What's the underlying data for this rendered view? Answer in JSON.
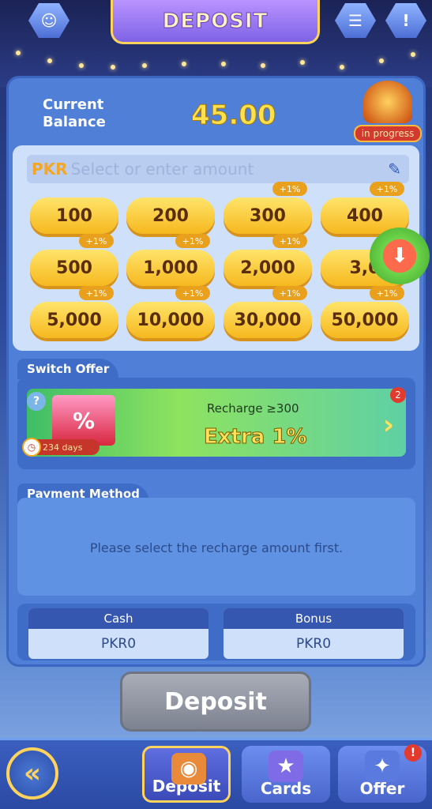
{
  "header": {
    "title": "DEPOSIT",
    "left_icon": "support-icon",
    "right_icons": [
      "notes-icon",
      "alert-icon"
    ]
  },
  "balance": {
    "label_line1": "Current",
    "label_line2": "Balance",
    "value": "45.00",
    "progress_badge": "in progress"
  },
  "amount": {
    "currency": "PKR",
    "placeholder": "Select or enter amount",
    "options": [
      {
        "value": "100",
        "bonus": ""
      },
      {
        "value": "200",
        "bonus": ""
      },
      {
        "value": "300",
        "bonus": "+1%"
      },
      {
        "value": "400",
        "bonus": "+1%"
      },
      {
        "value": "500",
        "bonus": "+1%"
      },
      {
        "value": "1,000",
        "bonus": "+1%"
      },
      {
        "value": "2,000",
        "bonus": "+1%"
      },
      {
        "value": "3,0",
        "bonus": ""
      },
      {
        "value": "5,000",
        "bonus": "+1%"
      },
      {
        "value": "10,000",
        "bonus": "+1%"
      },
      {
        "value": "30,000",
        "bonus": "+1%"
      },
      {
        "value": "50,000",
        "bonus": "+1%"
      }
    ]
  },
  "offer": {
    "section_label": "Switch Offer",
    "title": "Recharge ≥300",
    "extra": "Extra  1%",
    "days": "234 days",
    "count_badge": "2",
    "img_symbol": "%",
    "help": "?"
  },
  "payment": {
    "section_label": "Payment Method",
    "message": "Please select the recharge amount first."
  },
  "wallets": [
    {
      "label": "Cash",
      "value": "PKR0"
    },
    {
      "label": "Bonus",
      "value": "PKR0"
    }
  ],
  "deposit_button": "Deposit",
  "bottom_nav": [
    {
      "label": "Deposit",
      "icon": "coins-icon"
    },
    {
      "label": "Cards",
      "icon": "cards-icon"
    },
    {
      "label": "Offer",
      "icon": "offer-icon",
      "badge": "!"
    }
  ],
  "back_symbol": "«",
  "colors": {
    "accent_gold": "#ffe14d",
    "panel_blue": "#4f7fd6",
    "badge_red": "#e23a2f"
  }
}
